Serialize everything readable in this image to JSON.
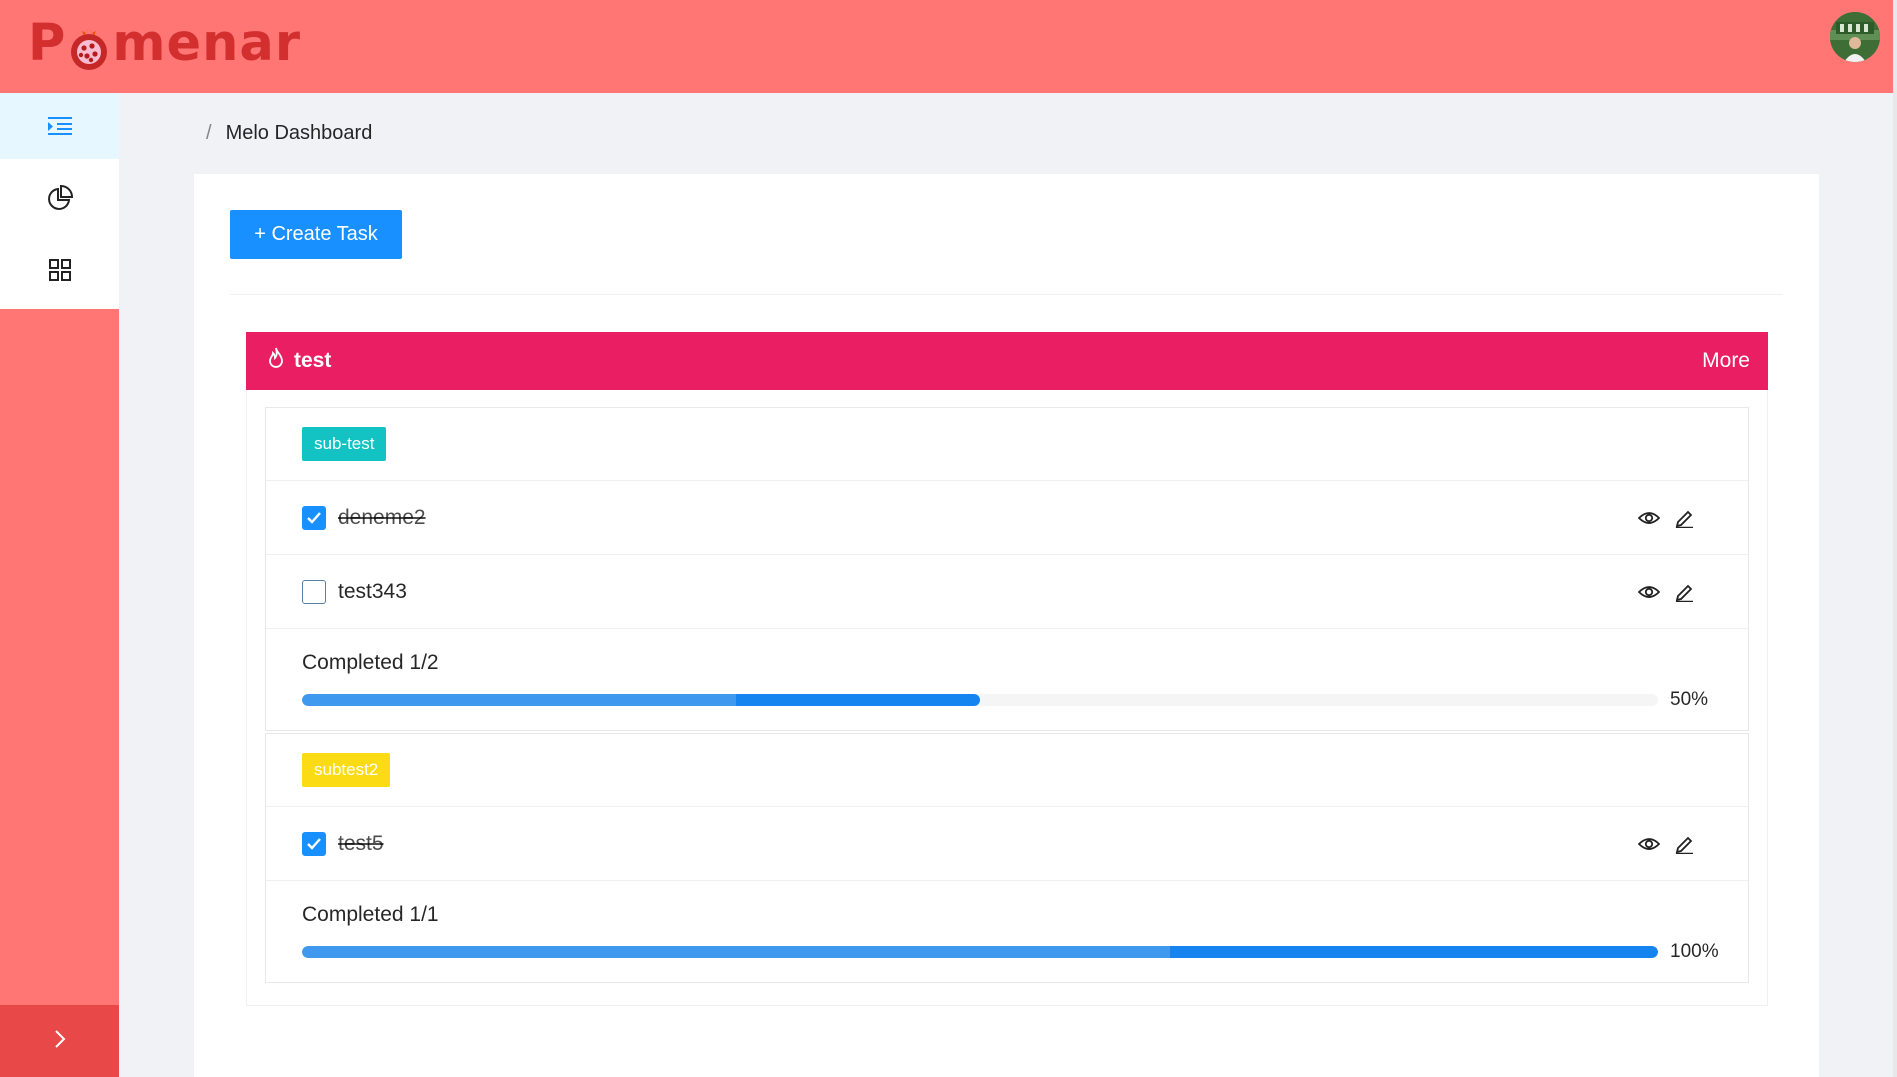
{
  "app": {
    "logo_text_pre": "P",
    "logo_text_post": "menar"
  },
  "breadcrumb": {
    "separator": "/",
    "current": "Melo Dashboard"
  },
  "toolbar": {
    "create_label": "+ Create Task"
  },
  "board": {
    "title": "test",
    "more_label": "More",
    "header_color": "#e91e63",
    "groups": [
      {
        "tag": "sub-test",
        "tag_color": "#13c2c2",
        "tasks": [
          {
            "name": "deneme2",
            "done": true
          },
          {
            "name": "test343",
            "done": false
          }
        ],
        "completed_label": "Completed 1/2",
        "progress": 0.5,
        "percent_label": "50%"
      },
      {
        "tag": "subtest2",
        "tag_color": "#fadb14",
        "tasks": [
          {
            "name": "test5",
            "done": true
          }
        ],
        "completed_label": "Completed 1/1",
        "progress": 1.0,
        "percent_label": "100%"
      }
    ]
  },
  "colors": {
    "header_bg": "#ff7675",
    "primary": "#1890ff",
    "collapse_bg": "#e84848"
  },
  "icons": {
    "sidebar": [
      "menu-list-icon",
      "pie-chart-icon",
      "appstore-grid-icon"
    ],
    "collapse": "chevron-right-icon",
    "task_view": "eye-icon",
    "task_edit": "edit-icon",
    "board": "fire-icon"
  }
}
